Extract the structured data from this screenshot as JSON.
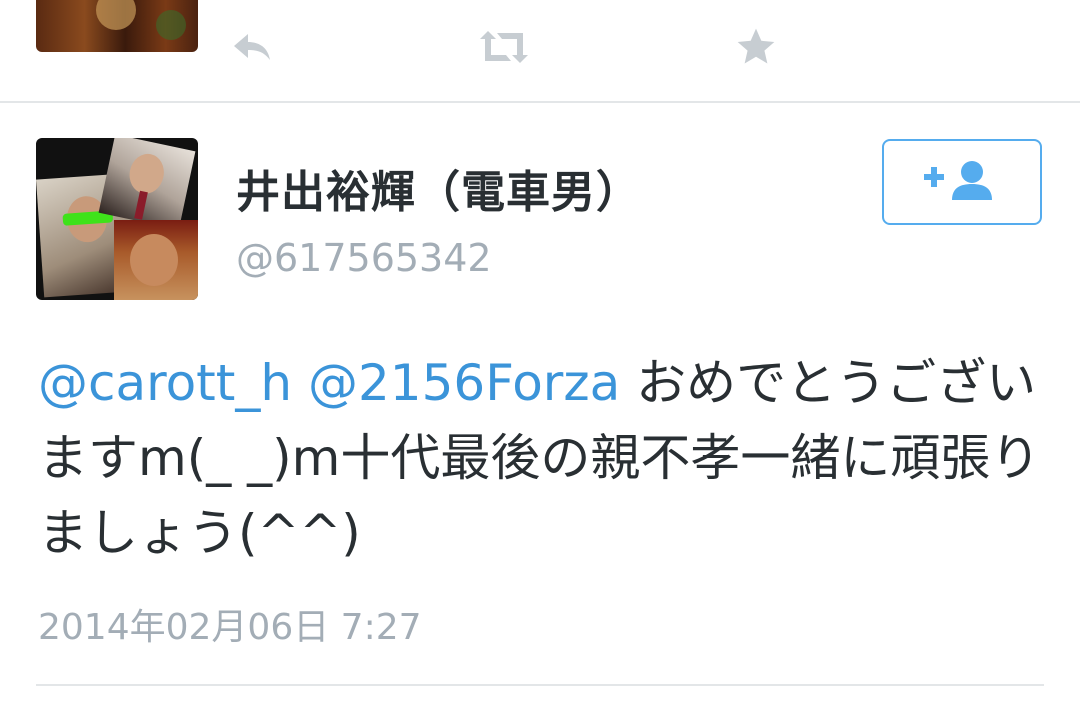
{
  "colors": {
    "text": "#292f33",
    "muted": "#a3adb6",
    "link": "#3b94d9",
    "follow_border": "#55acee",
    "action_icon": "#c7cdd2",
    "divider": "#e3e6e8"
  },
  "previous_tweet": {
    "actions": [
      {
        "name": "reply",
        "icon": "reply-icon"
      },
      {
        "name": "retweet",
        "icon": "retweet-icon"
      },
      {
        "name": "favorite",
        "icon": "star-icon"
      }
    ]
  },
  "tweet": {
    "author": {
      "display_name": "井出裕輝（電車男）",
      "screen_name": "@617565342"
    },
    "follow_button": {
      "icon": "follow-user-icon"
    },
    "mentions": [
      "@carott_h",
      "@2156Forza"
    ],
    "body": "おめでとうございますm(_ _)m十代最後の親不孝一緒に頑張りましょう(^^)",
    "timestamp": "2014年02月06日 7:27"
  }
}
